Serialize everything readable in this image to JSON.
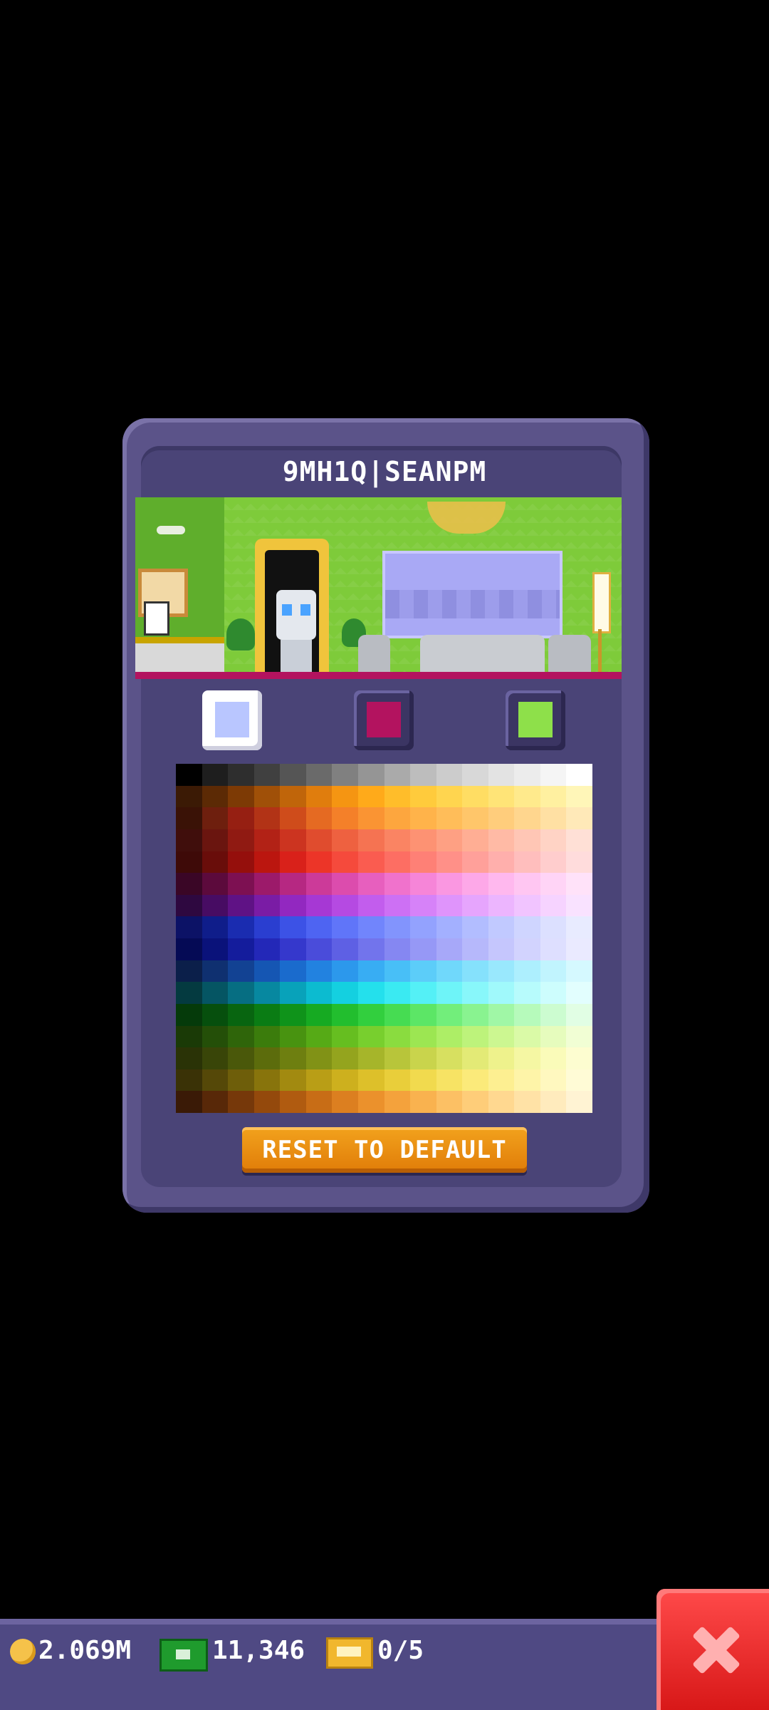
{
  "card": {
    "title": "9MH1Q|SEANPM"
  },
  "swatches": [
    {
      "name": "swatch-1",
      "color": "#b9c6ff",
      "selected": true
    },
    {
      "name": "swatch-2",
      "color": "#b3135f",
      "selected": false
    },
    {
      "name": "swatch-3",
      "color": "#8ee04a",
      "selected": false
    }
  ],
  "reset_button": {
    "label": "RESET TO DEFAULT"
  },
  "currency": {
    "coins": "2.069M",
    "cash": "11,346",
    "tickets": "0/5"
  },
  "palette_rows": [
    [
      "#000000",
      "#1e1e1e",
      "#2e2e2e",
      "#404040",
      "#555555",
      "#6a6a6a",
      "#808080",
      "#959595",
      "#aaaaaa",
      "#bdbdbd",
      "#cccccc",
      "#d8d8d8",
      "#e3e3e3",
      "#ececec",
      "#f5f5f5",
      "#ffffff"
    ],
    [
      "#3b1a05",
      "#5c2a05",
      "#7d3a05",
      "#a05008",
      "#c0650a",
      "#e07d0d",
      "#f59512",
      "#ffaa1a",
      "#ffbd2a",
      "#ffcb3c",
      "#ffd54f",
      "#ffdd63",
      "#ffe477",
      "#ffea8c",
      "#fff0a0",
      "#fff6b8"
    ],
    [
      "#3a1206",
      "#6e1f0e",
      "#961f12",
      "#b23316",
      "#cf4c1b",
      "#e56a22",
      "#f48029",
      "#fa9433",
      "#fda63e",
      "#ffb34a",
      "#ffbd59",
      "#ffc66a",
      "#ffcd7c",
      "#ffd68e",
      "#ffe0a3",
      "#ffe9b8"
    ],
    [
      "#400e0c",
      "#6a150f",
      "#901a12",
      "#b22216",
      "#cc3420",
      "#e04c2e",
      "#ee6140",
      "#f57352",
      "#fa8463",
      "#fd9273",
      "#fea083",
      "#ffae94",
      "#ffbaa5",
      "#ffc6b5",
      "#ffd3c5",
      "#ffe0d6"
    ],
    [
      "#3e0a08",
      "#690d0a",
      "#950f0c",
      "#bb160f",
      "#d9211a",
      "#ec3528",
      "#f54a3c",
      "#fa5c50",
      "#fd6e63",
      "#fe8076",
      "#ff9088",
      "#ffa09a",
      "#ffafac",
      "#ffbebd",
      "#ffcdcd",
      "#ffdcdc"
    ],
    [
      "#3a0626",
      "#5c0a3c",
      "#7d1052",
      "#9c1a6a",
      "#b62882",
      "#cc3a99",
      "#dc4cad",
      "#e75fbe",
      "#f072cc",
      "#f685d8",
      "#fa97e1",
      "#fda8e8",
      "#ffb8ee",
      "#ffc6f2",
      "#ffd4f6",
      "#ffe2f9"
    ],
    [
      "#2e0840",
      "#470c63",
      "#5f1285",
      "#7a1ca5",
      "#9228c0",
      "#a638d4",
      "#b54ae2",
      "#c25ded",
      "#cd70f4",
      "#d682f8",
      "#df94fb",
      "#e6a5fd",
      "#ecb5fe",
      "#f1c4ff",
      "#f6d3ff",
      "#f9e2ff"
    ],
    [
      "#0c1266",
      "#0f1d8a",
      "#1a2cb0",
      "#2a3ed0",
      "#3c52e6",
      "#4e64f2",
      "#6075f9",
      "#7185fc",
      "#8294fd",
      "#93a2fe",
      "#a3b0ff",
      "#b2bdff",
      "#c1c9ff",
      "#cfd5ff",
      "#dce0ff",
      "#e8ebff"
    ],
    [
      "#050a55",
      "#0a127a",
      "#141c9c",
      "#2328b8",
      "#3538cc",
      "#4a4cda",
      "#5e60e4",
      "#7274ec",
      "#8587f2",
      "#9698f6",
      "#a7a8f9",
      "#b6b8fb",
      "#c5c6fd",
      "#d2d3fe",
      "#dedfff",
      "#eaeaff"
    ],
    [
      "#0b1f4a",
      "#0f3070",
      "#124293",
      "#1556b3",
      "#1a6bcd",
      "#2282e0",
      "#2c98ec",
      "#38adf3",
      "#48bff7",
      "#5ccdf9",
      "#70d8fb",
      "#85e1fc",
      "#99e8fd",
      "#adeffe",
      "#c1f4fe",
      "#d5f9ff"
    ],
    [
      "#043a40",
      "#055563",
      "#066e82",
      "#0788a0",
      "#08a2ba",
      "#0cbbd0",
      "#14d0e0",
      "#24e0ec",
      "#3aeaf2",
      "#54f0f6",
      "#6ef4f8",
      "#88f7fa",
      "#a0f9fb",
      "#b7fbfc",
      "#cdfdfd",
      "#e2fefe"
    ],
    [
      "#053a0a",
      "#064f0d",
      "#086510",
      "#0a7c14",
      "#0f931a",
      "#16aa22",
      "#22be2e",
      "#32cf3e",
      "#46dc52",
      "#5ce666",
      "#72ee7b",
      "#89f390",
      "#a0f7a6",
      "#b6fabb",
      "#ccfcd0",
      "#e1fee4"
    ],
    [
      "#1a3a06",
      "#244f08",
      "#2f650a",
      "#3b7c0c",
      "#489310",
      "#56aa16",
      "#66be20",
      "#78cf2e",
      "#8adc3f",
      "#9ce652",
      "#adee66",
      "#bdf37b",
      "#ccf791",
      "#dafaa7",
      "#e6fcbd",
      "#f1fed4"
    ],
    [
      "#2a3306",
      "#394508",
      "#4a580a",
      "#5c6c0c",
      "#6e7f10",
      "#819216",
      "#94a41e",
      "#a6b52a",
      "#b8c53a",
      "#c9d44c",
      "#d7e060",
      "#e3ea76",
      "#eef28c",
      "#f5f7a3",
      "#fafbb9",
      "#fdfdd0"
    ],
    [
      "#3a3206",
      "#554808",
      "#6e5e0a",
      "#88740c",
      "#a28a10",
      "#b99e16",
      "#cdb01e",
      "#ddc02a",
      "#e9ce3a",
      "#f1da4e",
      "#f7e364",
      "#fbea7a",
      "#fdef91",
      "#fef4a8",
      "#fff8bf",
      "#fffbd6"
    ],
    [
      "#3a1a06",
      "#582808",
      "#76380a",
      "#94490c",
      "#b05b10",
      "#c86d16",
      "#dc7f20",
      "#eb912c",
      "#f4a23c",
      "#f9b24f",
      "#fcc064",
      "#fecd79",
      "#ffd890",
      "#ffe2a6",
      "#ffebbd",
      "#fff3d3"
    ]
  ]
}
